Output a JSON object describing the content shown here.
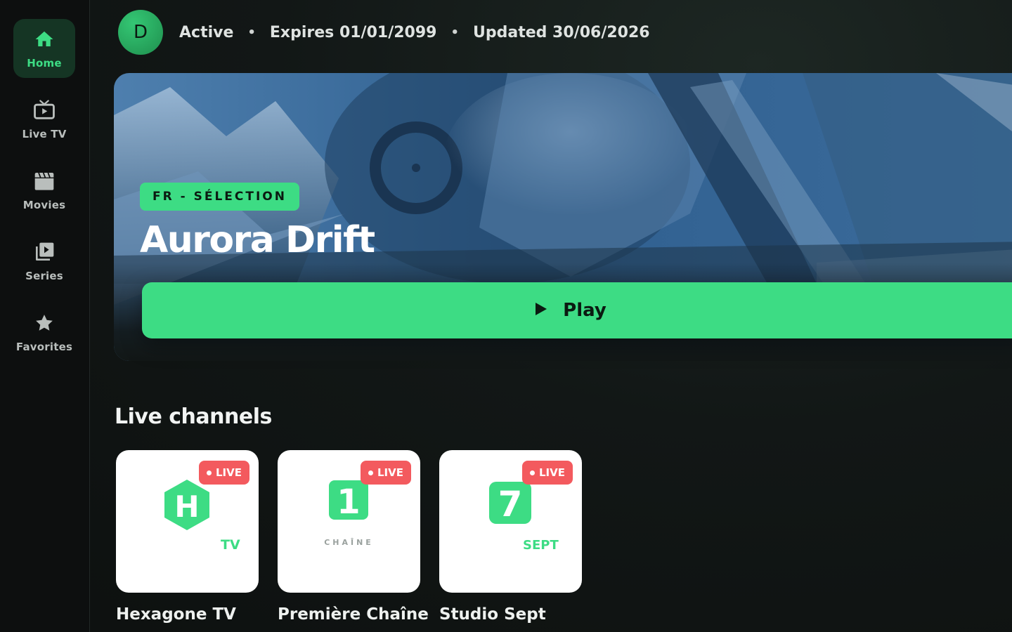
{
  "sidebar": {
    "items": [
      {
        "label": "Home",
        "icon": "home-icon",
        "active": true
      },
      {
        "label": "Live TV",
        "icon": "tv-icon",
        "active": false
      },
      {
        "label": "Movies",
        "icon": "clapperboard-icon",
        "active": false
      },
      {
        "label": "Series",
        "icon": "series-icon",
        "active": false
      },
      {
        "label": "Favorites",
        "icon": "star-icon",
        "active": false
      }
    ]
  },
  "header": {
    "avatar_initial": "D",
    "status": "Active",
    "separator": "•",
    "expires": "Expires 01/01/2099",
    "updated": "Updated 30/06/2026"
  },
  "hero": {
    "badge": "FR - SÉLECTION",
    "title": "Aurora Drift",
    "play_label": "Play"
  },
  "live_section": {
    "title": "Live channels",
    "live_label": "LIVE",
    "channels": [
      {
        "name": "Hexagone TV",
        "logo_mark": "H",
        "logo_text": "TV"
      },
      {
        "name": "Première Chaîne",
        "logo_mark": "1",
        "logo_text": "CHAÎNE"
      },
      {
        "name": "Studio Sept",
        "logo_mark": "7",
        "logo_text": "SEPT"
      }
    ]
  },
  "colors": {
    "accent": "#3ddc84",
    "live_badge": "#f35a5e",
    "background": "#0f1312"
  }
}
